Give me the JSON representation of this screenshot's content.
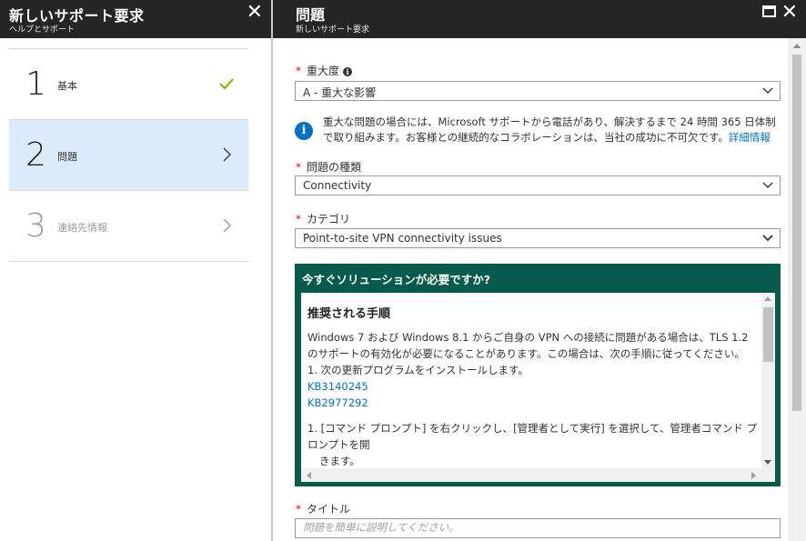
{
  "left_blade": {
    "title": "新しいサポート要求",
    "subtitle": "ヘルプとサポート",
    "close_icon": "close-icon",
    "steps": [
      {
        "number": "1",
        "label": "基本",
        "state": "completed",
        "icon": "checkmark-icon",
        "icon_color": "#7fba00"
      },
      {
        "number": "2",
        "label": "問題",
        "state": "active",
        "icon": "chevron-right-icon"
      },
      {
        "number": "3",
        "label": "連絡先情報",
        "state": "disabled",
        "icon": "chevron-right-icon"
      }
    ]
  },
  "right_blade": {
    "title": "問題",
    "subtitle": "新しいサポート要求",
    "maximize_icon": "maximize-icon",
    "close_icon": "close-icon"
  },
  "form": {
    "severity": {
      "required_mark": "*",
      "label": "重大度",
      "info_icon": "i",
      "value": "A - 重大な影響"
    },
    "notice": {
      "text": "重大な問題の場合には、Microsoft サポートから電話があり、解決するまで 24 時間 365 日体制で取り組みます。お客様との継続的なコラボレーションは、当社の成功に不可欠です。",
      "link": "詳細情報",
      "icon": "i"
    },
    "problem_type": {
      "required_mark": "*",
      "label": "問題の種類",
      "value": "Connectivity"
    },
    "category": {
      "required_mark": "*",
      "label": "カテゴリ",
      "value": "Point-to-site VPN connectivity issues"
    },
    "solution": {
      "header": "今すぐソリューションが必要ですか?",
      "title": "推奨される手順",
      "paragraph": "Windows 7 および Windows 8.1 からご自身の VPN への接続に問題がある場合は、TLS 1.2 のサポートの有効化が必要になることがあります。この場合は、次の手順に従ってください。",
      "step1": "1. 次の更新プログラムをインストールします。",
      "links": [
        "KB3140245",
        "KB2977292"
      ],
      "step2": "1. [コマンド プロンプト] を右クリックし、[管理者として実行] を選択して、管理者コマンド プロンプトを開",
      "step2_cont": "きます。"
    },
    "title_field": {
      "required_mark": "*",
      "label": "タイトル",
      "placeholder": "問題を簡単に説明してください。"
    }
  },
  "colors": {
    "header_bg": "#252526",
    "active_step_bg": "#dcebfa",
    "accent_blue": "#0072c6",
    "solution_box_bg": "#075b4c",
    "check_green": "#7fba00",
    "required_red": "#e00000"
  }
}
